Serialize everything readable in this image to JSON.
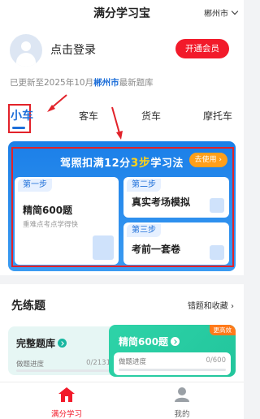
{
  "header": {
    "title": "满分学习宝",
    "city": "郴州市"
  },
  "user": {
    "login_text": "点击登录",
    "vip_button": "开通会员"
  },
  "update": {
    "prefix": "已更新至2025年10月",
    "city": "郴州市",
    "suffix": "最新题库"
  },
  "tabs": [
    {
      "label": "小车",
      "active": true
    },
    {
      "label": "客车",
      "active": false
    },
    {
      "label": "货车",
      "active": false
    },
    {
      "label": "摩托车",
      "active": false
    }
  ],
  "method": {
    "title_pre": "驾照扣满12分",
    "title_hl": "3步",
    "title_post": "学习法",
    "try_button": "去使用",
    "steps": [
      {
        "label": "第一步",
        "title": "精简600题",
        "sub": "重难点考点学得快"
      },
      {
        "label": "第二步",
        "title": "真实考场模拟"
      },
      {
        "label": "第三步",
        "title": "考前一套卷"
      }
    ]
  },
  "practice": {
    "title": "先练题",
    "link": "错题和收藏",
    "banks": [
      {
        "title": "完整题库",
        "progress_label": "做题进度",
        "done": "0",
        "total": "2131",
        "progress": 0
      },
      {
        "title": "精简600题",
        "progress_label": "做题进度",
        "done": "0",
        "total": "600",
        "progress": 0,
        "badge": "更高效"
      }
    ]
  },
  "nav": [
    {
      "label": "满分学习",
      "icon": "home-icon",
      "active": true
    },
    {
      "label": "我的",
      "icon": "profile-icon",
      "active": false
    }
  ],
  "colors": {
    "accent": "#1e6fd9",
    "brand_red": "#f21a2a",
    "highlight_yellow": "#ffd21a",
    "bank_green": "#2ed3a8"
  }
}
